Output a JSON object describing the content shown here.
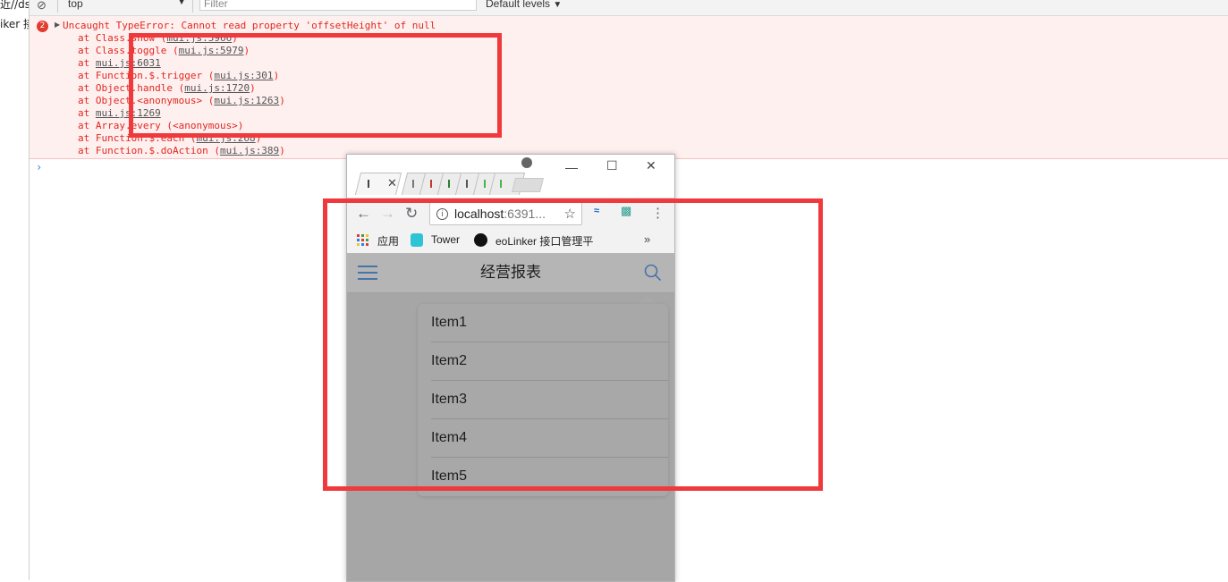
{
  "left_strip": {
    "tab1_text": "近//ds",
    "tab2_text": "iker 接"
  },
  "console": {
    "context": "top",
    "filter_placeholder": "Filter",
    "levels": "Default levels",
    "error_count": "2",
    "error_message": "Uncaught TypeError: Cannot read property 'offsetHeight' of null",
    "stack": [
      {
        "prefix": "at Class.show (",
        "file": "mui.js:5966",
        "suffix": ")"
      },
      {
        "prefix": "at Class.toggle (",
        "file": "mui.js:5979",
        "suffix": ")"
      },
      {
        "prefix": "at ",
        "file": "mui.js:6031",
        "suffix": ""
      },
      {
        "prefix": "at Function.$.trigger (",
        "file": "mui.js:301",
        "suffix": ")"
      },
      {
        "prefix": "at Object.handle (",
        "file": "mui.js:1720",
        "suffix": ")"
      },
      {
        "prefix": "at Object.<anonymous> (",
        "file": "mui.js:1263",
        "suffix": ")"
      },
      {
        "prefix": "at ",
        "file": "mui.js:1269",
        "suffix": ""
      },
      {
        "prefix": "at Array.every (<anonymous>)",
        "file": "",
        "suffix": ""
      },
      {
        "prefix": "at Function.$.each (",
        "file": "mui.js:268",
        "suffix": ")"
      },
      {
        "prefix": "at Function.$.doAction (",
        "file": "mui.js:389",
        "suffix": ")"
      }
    ],
    "prompt": "›"
  },
  "browser": {
    "url_host": "localhost",
    "url_port": ":6391...",
    "bookmarks": {
      "apps": "应用",
      "tower": "Tower",
      "eolinker": "eoLinker 接口管理平",
      "more": "»"
    },
    "app": {
      "title": "经营报表",
      "menu_items": [
        "Item1",
        "Item2",
        "Item3",
        "Item4",
        "Item5"
      ]
    }
  },
  "colors": {
    "annotation": "#f0393c",
    "error_text": "#e0281f",
    "error_bg": "#fff0f0",
    "overlay": "#a6a6a7",
    "icon_blue": "#4673a8"
  }
}
